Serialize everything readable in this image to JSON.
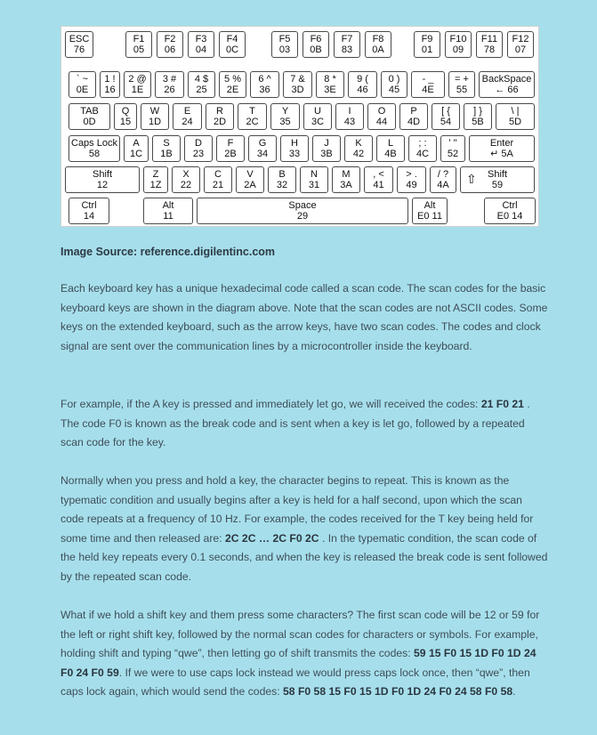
{
  "keyboard": {
    "keys": {
      "esc": [
        "ESC",
        "76"
      ],
      "f1": [
        "F1",
        "05"
      ],
      "f2": [
        "F2",
        "06"
      ],
      "f3": [
        "F3",
        "04"
      ],
      "f4": [
        "F4",
        "0C"
      ],
      "f5": [
        "F5",
        "03"
      ],
      "f6": [
        "F6",
        "0B"
      ],
      "f7": [
        "F7",
        "83"
      ],
      "f8": [
        "F8",
        "0A"
      ],
      "f9": [
        "F9",
        "01"
      ],
      "f10": [
        "F10",
        "09"
      ],
      "f11": [
        "F11",
        "78"
      ],
      "f12": [
        "F12",
        "07"
      ],
      "tilde": [
        "` ~",
        "0E"
      ],
      "k1": [
        "1 !",
        "16"
      ],
      "k2": [
        "2 @",
        "1E"
      ],
      "k3": [
        "3 #",
        "26"
      ],
      "k4": [
        "4 $",
        "25"
      ],
      "k5": [
        "5 %",
        "2E"
      ],
      "k6": [
        "6 ^",
        "36"
      ],
      "k7": [
        "7 &",
        "3D"
      ],
      "k8": [
        "8 *",
        "3E"
      ],
      "k9": [
        "9 (",
        "46"
      ],
      "k0": [
        "0 )",
        "45"
      ],
      "minus": [
        "- _",
        "4E"
      ],
      "equal": [
        "= +",
        "55"
      ],
      "backspace": [
        "BackSpace",
        "← 66"
      ],
      "tab": [
        "TAB",
        "0D"
      ],
      "q": [
        "Q",
        "15"
      ],
      "w": [
        "W",
        "1D"
      ],
      "e": [
        "E",
        "24"
      ],
      "r": [
        "R",
        "2D"
      ],
      "t": [
        "T",
        "2C"
      ],
      "y": [
        "Y",
        "35"
      ],
      "u": [
        "U",
        "3C"
      ],
      "i": [
        "I",
        "43"
      ],
      "o": [
        "O",
        "44"
      ],
      "p": [
        "P",
        "4D"
      ],
      "lbracket": [
        "[ {",
        "54"
      ],
      "rbracket": [
        "] }",
        "5B"
      ],
      "backslash": [
        "\\ |",
        "5D"
      ],
      "caps": [
        "Caps Lock",
        "58"
      ],
      "a": [
        "A",
        "1C"
      ],
      "s": [
        "S",
        "1B"
      ],
      "d": [
        "D",
        "23"
      ],
      "f": [
        "F",
        "2B"
      ],
      "g": [
        "G",
        "34"
      ],
      "h": [
        "H",
        "33"
      ],
      "j": [
        "J",
        "3B"
      ],
      "k": [
        "K",
        "42"
      ],
      "l": [
        "L",
        "4B"
      ],
      "semicolon": [
        "; :",
        "4C"
      ],
      "quote": [
        "' \"",
        "52"
      ],
      "enter": [
        "Enter",
        "↵ 5A"
      ],
      "lshift": [
        "Shift",
        "12"
      ],
      "z": [
        "Z",
        "1Z"
      ],
      "x": [
        "X",
        "22"
      ],
      "c": [
        "C",
        "21"
      ],
      "v": [
        "V",
        "2A"
      ],
      "b": [
        "B",
        "32"
      ],
      "n": [
        "N",
        "31"
      ],
      "m": [
        "M",
        "3A"
      ],
      "comma": [
        ", <",
        "41"
      ],
      "period": [
        "> .",
        "49"
      ],
      "slash": [
        "/ ?",
        "4A"
      ],
      "rshift": [
        "Shift",
        "59"
      ],
      "lctrl": [
        "Ctrl",
        "14"
      ],
      "lalt": [
        "Alt",
        "11"
      ],
      "space": [
        "Space",
        "29"
      ],
      "ralt": [
        "Alt",
        "E0 11"
      ],
      "rctrl": [
        "Ctrl",
        "E0 14"
      ]
    }
  },
  "source_label": "Image Source: reference.digilentinc.com",
  "p1": "Each keyboard key has a unique hexadecimal code called a scan code. The scan codes for the basic keyboard keys are shown in the diagram above.  Note that the scan codes are not ASCII codes. Some keys on the extended keyboard, such as the arrow keys, have two scan codes. The codes and clock signal are sent over the communication lines by a microcontroller inside the keyboard.",
  "p2": {
    "before": "For example, if the A key is pressed and immediately let go, we will received the codes: ",
    "code": "21 F0 21",
    "after": " . The code F0 is known as the break code and is sent when a key is let go, followed by a repeated scan code for the key."
  },
  "p3": {
    "before": "Normally when you press and hold a key, the character begins to repeat. This is known as the typematic condition and usually begins after a key is held for a half second, upon which the scan code repeats at a frequency of 10 Hz. For example, the codes received for the T key being held for some time and then released are: ",
    "code": "2C 2C … 2C F0 2C",
    "after": " . In the typematic condition, the scan code of the held key repeats every 0.1 seconds, and when the key is released the break code is sent followed by the repeated scan code."
  },
  "p4": {
    "before": "What if we hold a shift key and them press some characters? The first scan code will be 12 or 59 for the left or right shift key, followed by the normal scan codes for characters or symbols. For example, holding shift and typing “qwe”, then letting go of shift transmits the codes: ",
    "code1": "59 15 F0 15 1D F0 1D 24 F0 24 F0 59",
    "middle": ".  If we were to use caps lock instead we would press caps lock once, then “qwe”, then caps lock again, which would send the codes: ",
    "code2": "58 F0 58 15 F0 15 1D F0 1D 24 F0 24 58 F0 58",
    "after": "."
  }
}
